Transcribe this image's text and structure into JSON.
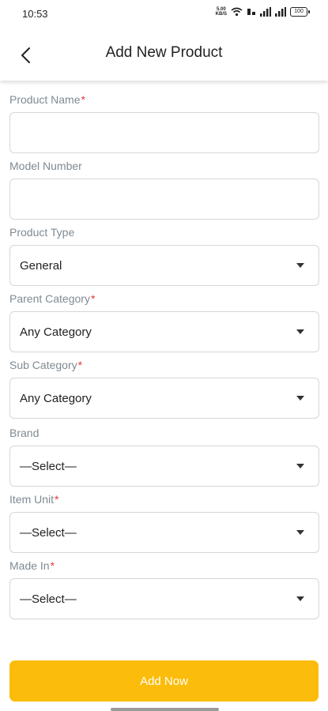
{
  "status_bar": {
    "time": "10:53",
    "net_speed_top": "5.00",
    "net_speed_bottom": "KB/S",
    "battery": "100"
  },
  "header": {
    "back_icon": "back-arrow-icon",
    "title": "Add New Product"
  },
  "form": {
    "product_name": {
      "label": "Product Name",
      "required": "*",
      "value": ""
    },
    "model_number": {
      "label": "Model Number",
      "value": ""
    },
    "product_type": {
      "label": "Product Type",
      "value": "General"
    },
    "parent_category": {
      "label": "Parent Category",
      "required": "*",
      "value": "Any Category"
    },
    "sub_category": {
      "label": "Sub Category",
      "required": "*",
      "value": "Any Category"
    },
    "brand": {
      "label": "Brand",
      "value": "—Select—"
    },
    "item_unit": {
      "label": "Item Unit",
      "required": "*",
      "value": "—Select—"
    },
    "made_in": {
      "label": "Made In",
      "required": "*",
      "value": "—Select—"
    }
  },
  "actions": {
    "add_now_label": "Add Now"
  },
  "colors": {
    "accent": "#fbbc0b",
    "required": "#e53935",
    "label": "#7f8a92",
    "border": "#d4d6d9"
  }
}
